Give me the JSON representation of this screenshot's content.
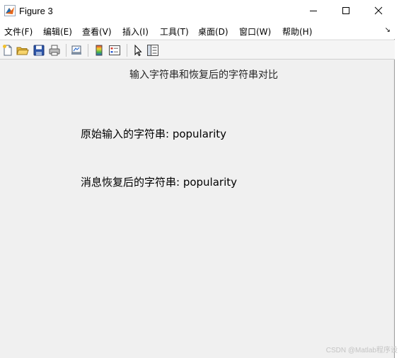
{
  "window": {
    "title": "Figure 3",
    "controls": [
      "minimize",
      "maximize",
      "close"
    ]
  },
  "menubar": {
    "items": [
      {
        "label": "文件(F)"
      },
      {
        "label": "编辑(E)"
      },
      {
        "label": "查看(V)"
      },
      {
        "label": "插入(I)"
      },
      {
        "label": "工具(T)"
      },
      {
        "label": "桌面(D)"
      },
      {
        "label": "窗口(W)"
      },
      {
        "label": "帮助(H)"
      }
    ],
    "overflow_icon": "dock-arrow-icon"
  },
  "toolbar": {
    "icons": [
      "new-figure-icon",
      "open-folder-icon",
      "save-icon",
      "print-icon",
      "link-plot-icon",
      "colorbar-icon",
      "legend-icon",
      "pointer-icon",
      "property-inspector-icon"
    ]
  },
  "figure": {
    "title": "输入字符串和恢复后的字符串对比",
    "original_line": "原始输入的字符串: popularity",
    "recovered_line": "消息恢复后的字符串: popularity"
  },
  "watermark": "CSDN @Matlab程序设"
}
